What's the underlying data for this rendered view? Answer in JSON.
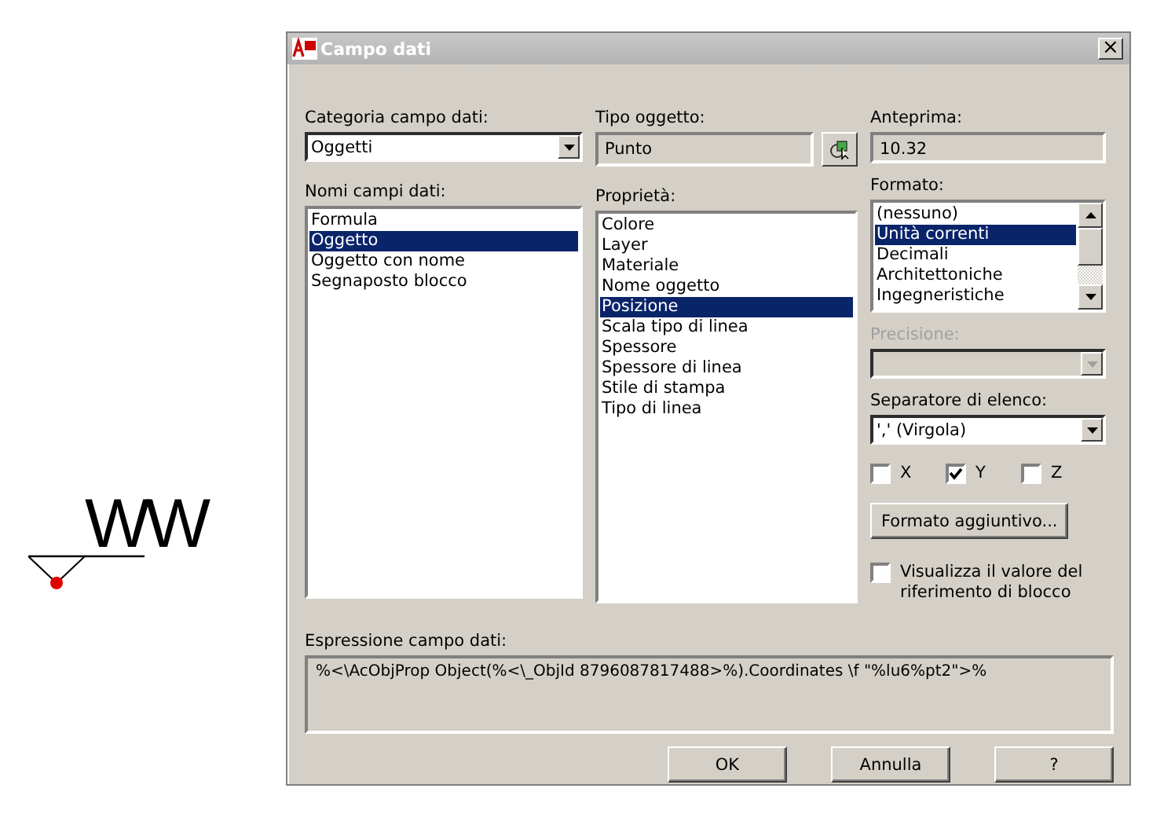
{
  "drawing": {
    "text": "WW"
  },
  "window": {
    "title": "Campo dati",
    "close": "×"
  },
  "category": {
    "label": "Categoria campo dati:",
    "value": "Oggetti"
  },
  "object_type": {
    "label": "Tipo oggetto:",
    "value": "Punto"
  },
  "preview": {
    "label": "Anteprima:",
    "value": "10.32"
  },
  "field_names": {
    "label": "Nomi campi dati:",
    "items": [
      {
        "text": "Formula",
        "selected": false
      },
      {
        "text": "Oggetto",
        "selected": true
      },
      {
        "text": "Oggetto con nome",
        "selected": false
      },
      {
        "text": "Segnaposto blocco",
        "selected": false
      }
    ]
  },
  "properties": {
    "label": "Proprietà:",
    "items": [
      {
        "text": "Colore",
        "selected": false
      },
      {
        "text": "Layer",
        "selected": false
      },
      {
        "text": "Materiale",
        "selected": false
      },
      {
        "text": "Nome oggetto",
        "selected": false
      },
      {
        "text": "Posizione",
        "selected": true
      },
      {
        "text": "Scala tipo di linea",
        "selected": false
      },
      {
        "text": "Spessore",
        "selected": false
      },
      {
        "text": "Spessore di linea",
        "selected": false
      },
      {
        "text": "Stile di stampa",
        "selected": false
      },
      {
        "text": "Tipo di linea",
        "selected": false
      }
    ]
  },
  "format": {
    "label": "Formato:",
    "items": [
      {
        "text": "(nessuno)",
        "selected": false
      },
      {
        "text": "Unità correnti",
        "selected": true
      },
      {
        "text": "Decimali",
        "selected": false
      },
      {
        "text": "Architettoniche",
        "selected": false
      },
      {
        "text": "Ingegneristiche",
        "selected": false
      }
    ]
  },
  "precision": {
    "label": "Precisione:",
    "disabled": true
  },
  "separator": {
    "label": "Separatore di elenco:",
    "value": "',' (Virgola)"
  },
  "axes": [
    {
      "label": "X",
      "checked": false
    },
    {
      "label": "Y",
      "checked": true
    },
    {
      "label": "Z",
      "checked": false
    }
  ],
  "additional_format_button": "Formato aggiuntivo...",
  "block_reference": {
    "label": "Visualizza il valore del riferimento di blocco",
    "checked": false
  },
  "expression": {
    "label": "Espressione campo dati:",
    "value": "%<\\AcObjProp Object(%<\\_ObjId 8796087817488>%).Coordinates \\f \"%lu6%pt2\">%"
  },
  "buttons": [
    "OK",
    "Annulla",
    "?"
  ]
}
